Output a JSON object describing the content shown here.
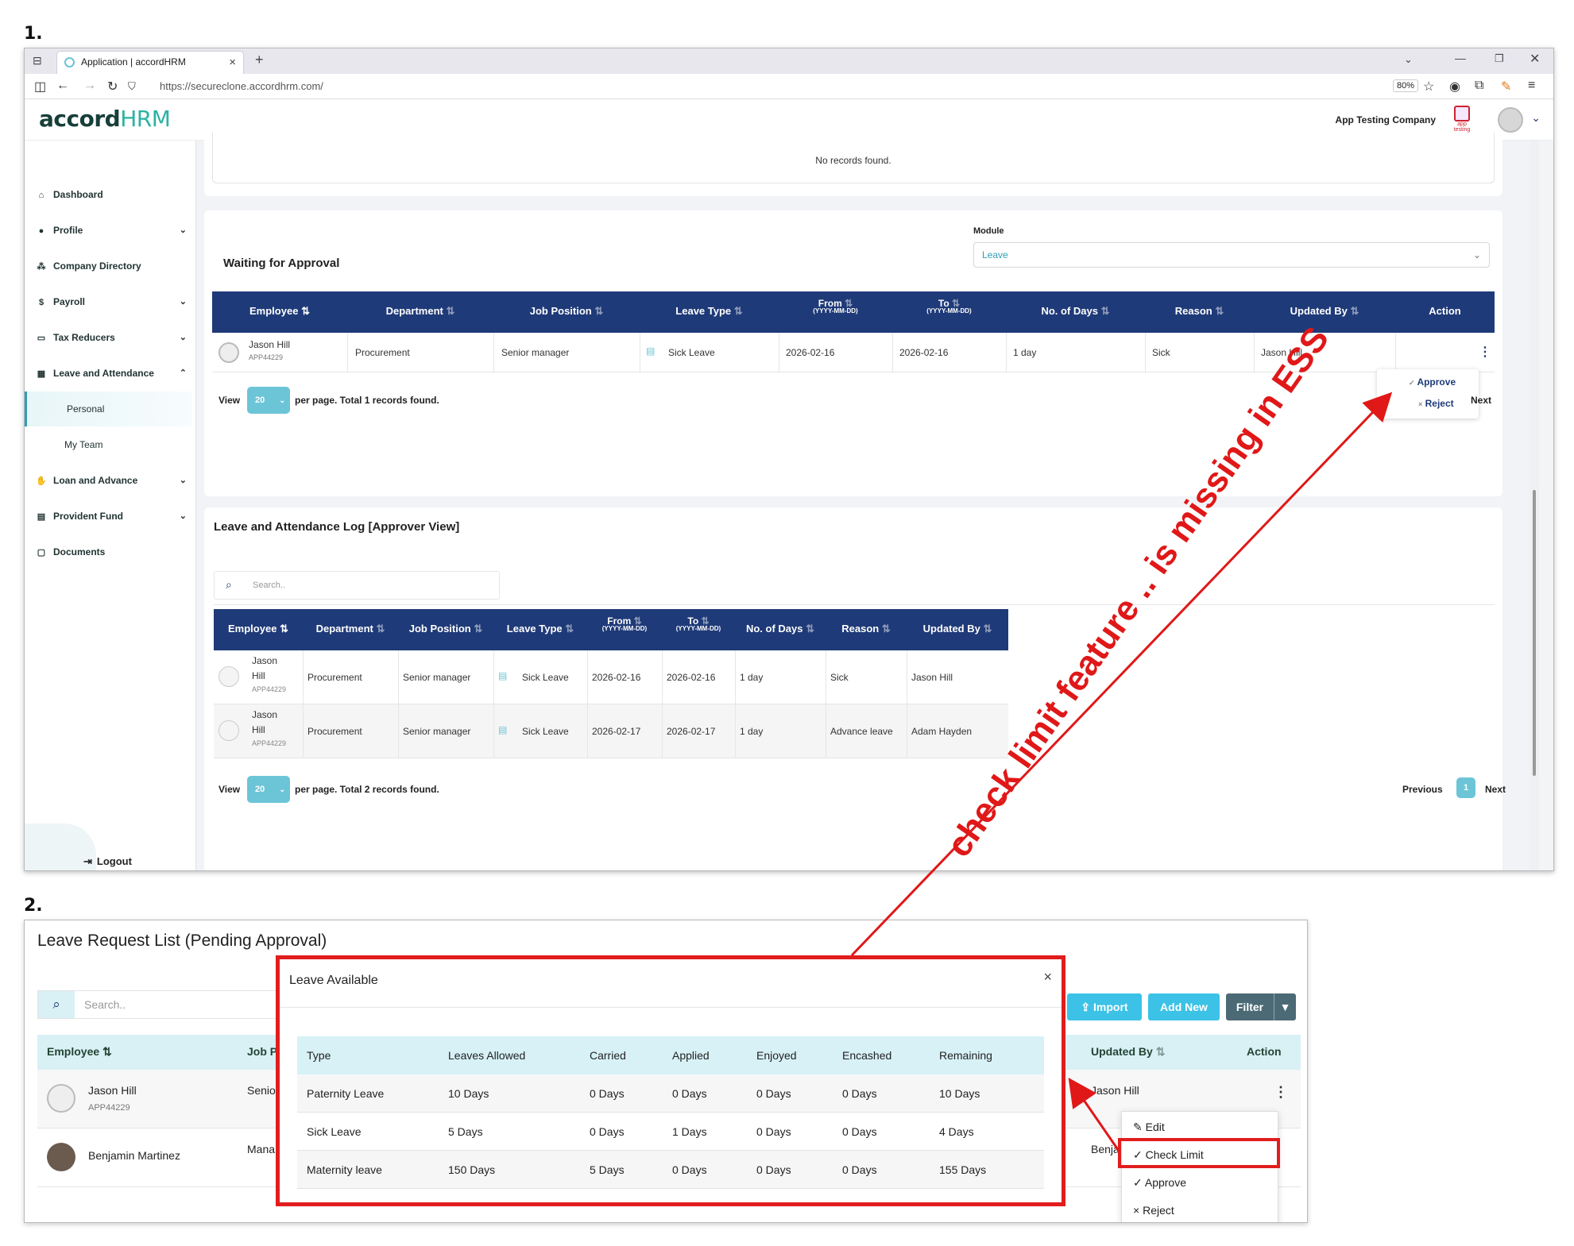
{
  "labels": {
    "one": "1.",
    "two": "2."
  },
  "browser": {
    "tab_title": "Application | accordHRM",
    "url": "https://secureclone.accordhrm.com/",
    "zoom": "80%"
  },
  "app": {
    "logo_main": "accord",
    "logo_suffix": "HRM",
    "company": "App Testing Company",
    "company_logo_caption": "app testing"
  },
  "sidebar": {
    "items": [
      {
        "label": "Dashboard",
        "icon": "home-icon"
      },
      {
        "label": "Profile",
        "icon": "user-icon"
      },
      {
        "label": "Company Directory",
        "icon": "users-icon"
      },
      {
        "label": "Payroll",
        "icon": "dollar-icon"
      },
      {
        "label": "Tax Reducers",
        "icon": "card-icon"
      },
      {
        "label": "Leave and Attendance",
        "icon": "calendar-icon"
      },
      {
        "label": "Loan and Advance",
        "icon": "hand-coin-icon"
      },
      {
        "label": "Provident Fund",
        "icon": "document-icon"
      },
      {
        "label": "Documents",
        "icon": "folder-icon"
      }
    ],
    "sub_items": [
      "Personal",
      "My Team"
    ],
    "logout": "Logout"
  },
  "top_card": {
    "empty_text": "No records found."
  },
  "waiting": {
    "title": "Waiting for Approval",
    "module_label": "Module",
    "module_value": "Leave",
    "headers": [
      "Employee",
      "Department",
      "Job Position",
      "Leave Type",
      "From",
      "To",
      "No. of Days",
      "Reason",
      "Updated By",
      "Action"
    ],
    "date_format": "(YYYY-MM-DD)",
    "row": {
      "name": "Jason Hill",
      "id": "APP44229",
      "department": "Procurement",
      "position": "Senior manager",
      "leave_type": "Sick Leave",
      "from": "2026-02-16",
      "to": "2026-02-16",
      "days": "1 day",
      "reason": "Sick",
      "updated_by": "Jason Hill"
    },
    "menu": [
      "Approve",
      "Reject"
    ],
    "view_label": "View",
    "page_size": "20",
    "footer": "per page. Total 1 records found.",
    "next": "Next"
  },
  "log": {
    "title": "Leave and Attendance Log [Approver View]",
    "search_placeholder": "Search..",
    "headers": [
      "Employee",
      "Department",
      "Job Position",
      "Leave Type",
      "From",
      "To",
      "No. of Days",
      "Reason",
      "Updated By"
    ],
    "rows": [
      {
        "first": "Jason",
        "last": "Hill",
        "id": "APP44229",
        "department": "Procurement",
        "position": "Senior manager",
        "leave_type": "Sick Leave",
        "from": "2026-02-16",
        "to": "2026-02-16",
        "days": "1 day",
        "reason": "Sick",
        "updated_by": "Jason Hill"
      },
      {
        "first": "Jason",
        "last": "Hill",
        "id": "APP44229",
        "department": "Procurement",
        "position": "Senior manager",
        "leave_type": "Sick Leave",
        "from": "2026-02-17",
        "to": "2026-02-17",
        "days": "1 day",
        "reason": "Advance leave",
        "updated_by": "Adam Hayden"
      }
    ],
    "view_label": "View",
    "page_size": "20",
    "footer": "per page. Total 2 records found.",
    "previous": "Previous",
    "page": "1",
    "next": "Next"
  },
  "annotation": "check limit feature .. is missing in ESS",
  "shot2": {
    "title": "Leave Request List (Pending Approval)",
    "search_placeholder": "Search..",
    "buttons": {
      "import": "Import",
      "add_new": "Add New",
      "filter": "Filter"
    },
    "headers": {
      "employee": "Employee",
      "job": "Job P",
      "updated_by": "Updated By",
      "action": "Action"
    },
    "rows": [
      {
        "name": "Jason Hill",
        "id": "APP44229",
        "job": "Senio",
        "updated": "Jason Hill"
      },
      {
        "name": "Benjamin Martinez",
        "id": "",
        "job": "Mana",
        "updated": "Benjan"
      }
    ],
    "menu": [
      "Edit",
      "Check Limit",
      "Approve",
      "Reject"
    ],
    "modal": {
      "title": "Leave Available",
      "close": "×",
      "headers": [
        "Type",
        "Leaves Allowed",
        "Carried",
        "Applied",
        "Enjoyed",
        "Encashed",
        "Remaining"
      ],
      "rows": [
        [
          "Paternity Leave",
          "10 Days",
          "0 Days",
          "0 Days",
          "0 Days",
          "0 Days",
          "10 Days"
        ],
        [
          "Sick Leave",
          "5 Days",
          "0 Days",
          "1 Days",
          "0 Days",
          "0 Days",
          "4 Days"
        ],
        [
          "Maternity leave",
          "150 Days",
          "5 Days",
          "0 Days",
          "0 Days",
          "0 Days",
          "155 Days"
        ]
      ]
    }
  },
  "colors": {
    "table_header": "#1f3a78",
    "accent": "#6cc5d7",
    "annotation": "#e01818",
    "light_header": "#d9f0f5"
  }
}
